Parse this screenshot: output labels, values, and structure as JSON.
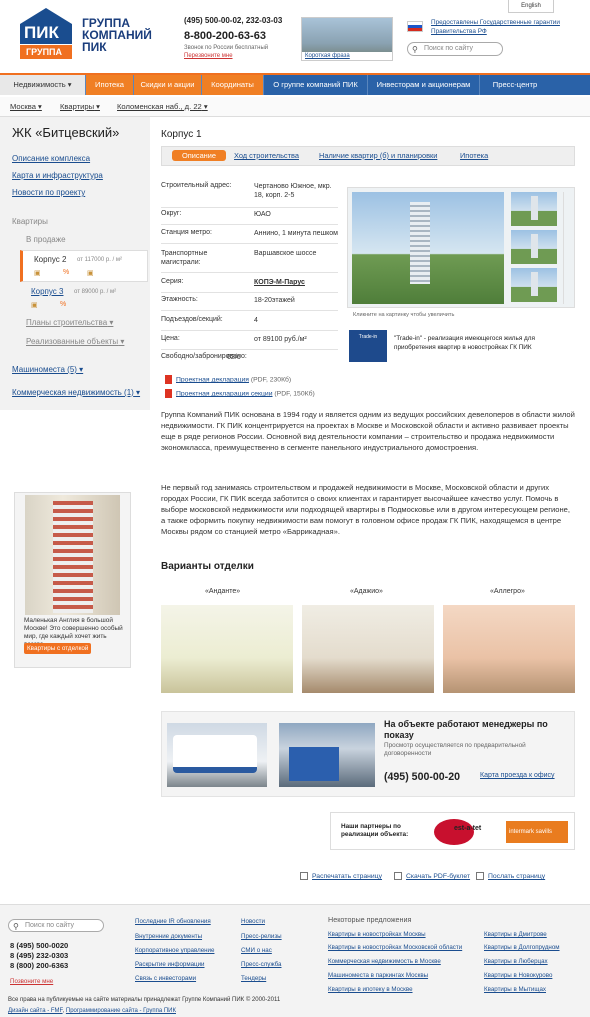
{
  "header": {
    "logo_text_top": "ПИК",
    "logo_text_bottom": "ГРУППА",
    "brand_line1": "ГРУППА",
    "brand_line2": "КОМПАНИЙ",
    "brand_line3": "ПИК",
    "phone1": "(495) 500-00-02, 232-03-03",
    "phone2": "8-800-200-63-63",
    "phone_note": "Звонок по России бесплатный",
    "callback": "Перезвоните мне",
    "promo": "Короткая фраза",
    "lang": "English",
    "gov_link": "Предоставлены Государственные гарантии Правительства РФ",
    "search_placeholder": "Поиск по сайту"
  },
  "nav": {
    "items": [
      "Недвижимость",
      "Ипотека",
      "Скидки и акции",
      "Координаты",
      "О группе компаний ПИК",
      "Инвесторам и акционерам",
      "Пресс-центр"
    ]
  },
  "breadcrumb": [
    "Москва",
    "Квартиры",
    "Коломенская наб., д. 22"
  ],
  "left": {
    "title": "ЖК «Битцевский»",
    "links": [
      "Описание комплекса",
      "Карта и инфраструктура",
      "Новости по проекту"
    ],
    "apartments": "Квартиры",
    "on_sale": "В продаже",
    "corp2": "Корпус 2",
    "corp2_price": "от 117000 р. / м²",
    "corp3": "Корпус 3",
    "corp3_price": "от 89000 р. / м²",
    "plans": "Планы строительства",
    "done": "Реализованные объекты",
    "parking": "Машиноместа (5)",
    "commercial": "Коммерческая недвижимость (1)",
    "ad_text": "Маленькая Англия в большой Москве! Это совершенно особый мир, где каждый хочет жить всегда",
    "ad_button": "Квартиры с отделкой"
  },
  "main": {
    "title": "Корпус 1",
    "tabs": [
      "Описание",
      "Ход строительства",
      "Наличие квартир (б) и планировки",
      "Ипотека"
    ],
    "props": [
      {
        "k": "Строительный адрес:",
        "v": "Чертаново Южное, мкр. 18, корп. 2-5"
      },
      {
        "k": "Округ:",
        "v": "ЮАО"
      },
      {
        "k": "Станция метро:",
        "v": "Аннино, 1 минута пешком"
      },
      {
        "k": "Транспортные магистрали:",
        "v": "Варшавское шоссе"
      },
      {
        "k": "Серия:",
        "v": "КОПЭ-М-Парус"
      },
      {
        "k": "Этажность:",
        "v": "18-20этажей"
      },
      {
        "k": "Подъездов/секций:",
        "v": "4"
      },
      {
        "k": "Цена:",
        "v": "от 89100 руб./м²"
      },
      {
        "k": "Свободно/забронировано:",
        "v": "62/6"
      }
    ],
    "photo_caption": "Кликните на картинку чтобы увеличить",
    "trade_logo": "Trade-in",
    "trade_text": "\"Trade-in\" - реализация имеющегося жилья для приобретения квартир в новостройках ГК ПИК",
    "doc1": "Проектная декларация",
    "doc1_meta": "(PDF, 230Кб)",
    "doc2": "Проектная декларация секции",
    "doc2_meta": "(PDF, 150Кб)",
    "para1": "Группа Компаний ПИК основана в 1994 году и является одним из ведущих российских девелоперов в области жилой недвижимости. ГК ПИК концентрируется на проектах в Москве и Московской области и активно развивает проекты еще в ряде регионов России. Основной вид деятельности компании – строительство и продажа недвижимости экономкласса, преимущественно в сегменте панельного индустриального домостроения.",
    "para2": "Не первый год занимаясь строительством и продажей недвижимости в Москве, Московской области и других городах России, ГК ПИК всегда заботится о своих клиентах и гарантирует высочайшее качество услуг. Помочь в выборе московской недвижимости или подходящей квартиры в Подмосковье или в другом интересующем регионе, а также оформить покупку недвижимости вам помогут в головном офисе продаж ГК ПИК, находящемся в центре Москвы рядом со станцией метро «Баррикадная».",
    "variants_title": "Варианты отделки",
    "variants": [
      "«Анданте»",
      "«Адажио»",
      "«Аллегро»"
    ],
    "contact_title": "На объекте работают менеджеры по показу",
    "contact_sub": "Просмотр осуществляется по предварительной договоренности",
    "contact_phone": "(495) 500-00-20",
    "contact_map": "Карта проезда к офису",
    "partners_title": "Наши партнеры по реализации объекта:",
    "partner1": "est-a-tet",
    "partner2": "intermark savills",
    "actions": [
      "Распечатать страницу",
      "Скачать PDF-буклет",
      "Послать страницу"
    ]
  },
  "footer": {
    "search_placeholder": "Поиск по сайту",
    "phones": [
      "8 (495) 500-0020",
      "8 (495) 232-0303",
      "8 (800) 200-6363"
    ],
    "callback": "Позвоните мне",
    "col1": [
      "Последние IR обновления",
      "Внутренние документы",
      "Корпоративное управление",
      "Раскрытие информации",
      "Связь с инвесторами"
    ],
    "col2": [
      "Новости",
      "Пресс-релизы",
      "СМИ о нас",
      "Пресс-служба",
      "Тендеры"
    ],
    "offers_title": "Некоторые предложения",
    "offers1": [
      "Квартиры в новостройках Москвы",
      "Квартиры в новостройках Московской области",
      "Коммерческая недвижимость в Москве",
      "Машиноместа в паркингах Москвы",
      "Квартиры в ипотеку в Москве"
    ],
    "offers2": [
      "Квартиры в Дмитрове",
      "Квартиры в Долгопрудном",
      "Квартиры в Люберцах",
      "Квартиры в Новокурово",
      "Квартиры в Мытищах"
    ],
    "copyright": "Все права на публикуемые на сайте материалы принадлежат Группе Компаний ПИК © 2000-2011",
    "credits_a": "Дизайн сайта - FMF",
    "credits_b": "Программирование сайта - Группа ПИК"
  }
}
